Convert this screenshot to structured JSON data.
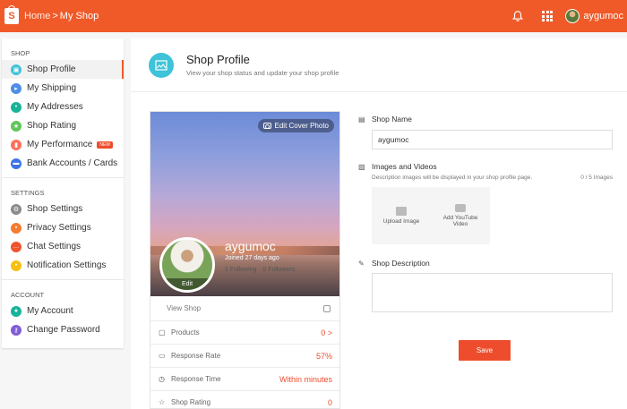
{
  "topbar": {
    "logo_letter": "S",
    "crumb_home": "Home",
    "crumb_sep": ">",
    "crumb_current": "My Shop",
    "username": "aygumoc"
  },
  "sidebar": {
    "sections": [
      {
        "title": "SHOP",
        "items": [
          {
            "label": "Shop Profile",
            "icon": "shop-profile-icon",
            "color": "#3ec3d8",
            "active": true
          },
          {
            "label": "My Shipping",
            "icon": "truck-icon",
            "color": "#4d8fe8"
          },
          {
            "label": "My Addresses",
            "icon": "map-pin-icon",
            "color": "#19b39a"
          },
          {
            "label": "Shop Rating",
            "icon": "star-icon",
            "color": "#60c65a"
          },
          {
            "label": "My Performance",
            "icon": "chart-icon",
            "color": "#ff6f5c",
            "badge": "NEW"
          },
          {
            "label": "Bank Accounts / Cards",
            "icon": "card-icon",
            "color": "#3d74e6"
          }
        ]
      },
      {
        "title": "SETTINGS",
        "items": [
          {
            "label": "Shop Settings",
            "icon": "gear-icon",
            "color": "#8c8c8c"
          },
          {
            "label": "Privacy Settings",
            "icon": "lock-icon",
            "color": "#f47b2f"
          },
          {
            "label": "Chat Settings",
            "icon": "chat-icon",
            "color": "#f0542f"
          },
          {
            "label": "Notification Settings",
            "icon": "bell-icon",
            "color": "#f5c013"
          }
        ]
      },
      {
        "title": "ACCOUNT",
        "items": [
          {
            "label": "My Account",
            "icon": "user-icon",
            "color": "#19b39a"
          },
          {
            "label": "Change Password",
            "icon": "key-icon",
            "color": "#7f5dd6"
          }
        ]
      }
    ]
  },
  "header": {
    "title": "Shop Profile",
    "subtitle": "View your shop status and update your shop profile"
  },
  "card": {
    "edit_cover": "Edit Cover Photo",
    "shop_name": "aygumoc",
    "joined": "Joined 27 days ago",
    "following": "1 Following",
    "followers": "0 Followers",
    "avatar_edit": "Edit",
    "view_shop": "View Shop",
    "stats": [
      {
        "label": "Products",
        "value": "0 >",
        "icon": "box-icon"
      },
      {
        "label": "Response Rate",
        "value": "57%",
        "icon": "chat-bubble-icon"
      },
      {
        "label": "Response Time",
        "value": "Within minutes",
        "icon": "clock-icon"
      },
      {
        "label": "Shop Rating",
        "value": "0",
        "icon": "star-icon"
      }
    ]
  },
  "form": {
    "shop_name_label": "Shop Name",
    "shop_name_value": "aygumoc",
    "images_label": "Images and Videos",
    "images_desc": "Description images will be displayed in your shop profile page.",
    "images_count": "0 / 5 Images",
    "upload_image": "Upload Image",
    "add_video": "Add YouTube Video",
    "desc_label": "Shop Description",
    "save": "Save"
  }
}
